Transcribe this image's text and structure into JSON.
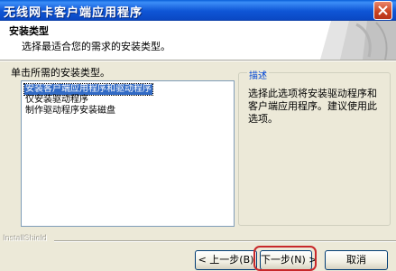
{
  "window": {
    "title": "无线网卡客户端应用程序"
  },
  "header": {
    "title": "安装类型",
    "subtitle": "选择最适合您的需求的安装类型。"
  },
  "main": {
    "instruction": "单击所需的安装类型。",
    "setup_types": [
      {
        "label": "安装客户端应用程序和驱动程序",
        "selected": true
      },
      {
        "label": "仅安装驱动程序",
        "selected": false
      },
      {
        "label": "制作驱动程序安装磁盘",
        "selected": false
      }
    ],
    "description": {
      "title": "描述",
      "text": "选择此选项将安装驱动程序和客户端应用程序。建议使用此选项。"
    }
  },
  "footer": {
    "brand": "InstallShield",
    "back_label": "< 上一步(B)",
    "next_label": "下一步(N) >",
    "cancel_label": "取消"
  },
  "colors": {
    "titlebar": "#0a5fd8",
    "selection": "#316ac5",
    "highlight_ring": "#c8282a"
  }
}
